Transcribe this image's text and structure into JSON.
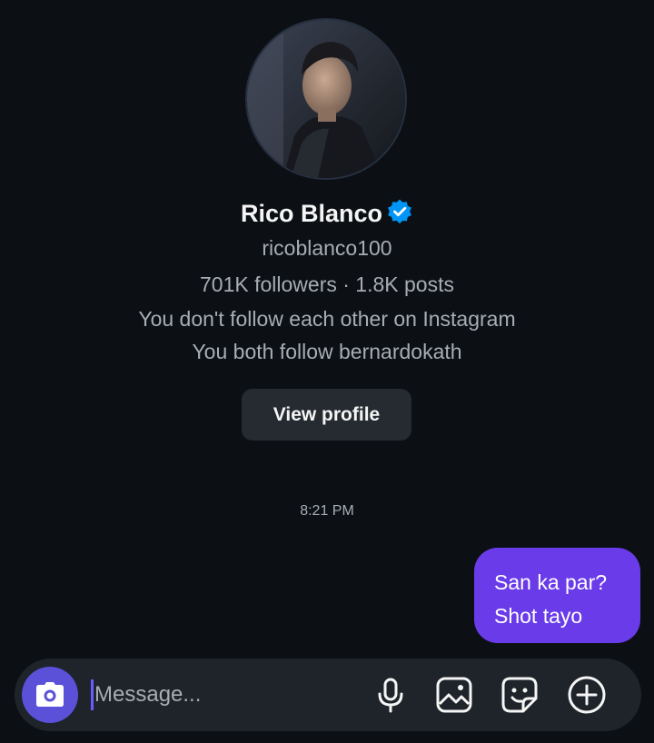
{
  "profile": {
    "name": "Rico Blanco",
    "username": "ricoblanco100",
    "stats": "701K followers · 1.8K posts",
    "follow_status": "You don't follow each other on Instagram",
    "mutual": "You both follow bernardokath",
    "view_profile_label": "View profile",
    "avatar_icon": "person-photo",
    "verified_icon": "verified-badge-icon"
  },
  "conversation": {
    "timestamp": "8:21 PM",
    "messages": [
      {
        "from": "me",
        "lines": [
          "San ka par?",
          "Shot tayo"
        ]
      }
    ]
  },
  "composer": {
    "placeholder": "Message...",
    "icons": [
      "camera-icon",
      "microphone-icon",
      "gallery-icon",
      "sticker-icon",
      "add-icon"
    ]
  },
  "colors": {
    "background": "#0c1014",
    "accent": "#5b51d8",
    "bubble": "#6a3be8",
    "verified": "#0095f6",
    "secondary_text": "#a8adb4"
  }
}
